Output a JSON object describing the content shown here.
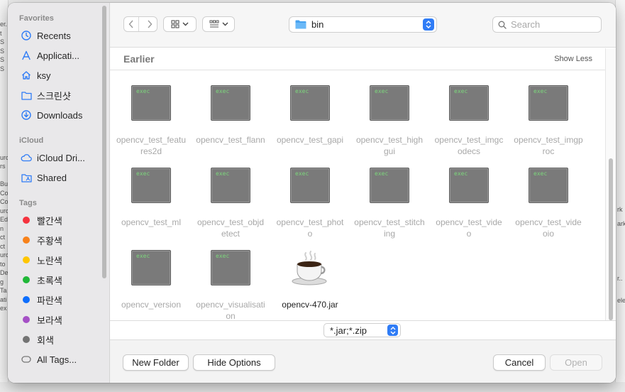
{
  "background": {
    "left_fragments": [
      "er.",
      "t",
      "S",
      "S",
      "S",
      "S",
      "",
      "",
      "",
      "",
      "",
      "",
      "",
      "",
      "",
      "urc",
      "rs",
      "",
      "Bu",
      "Co",
      "Co",
      "urc",
      "Ed",
      "n",
      "ct",
      "ct",
      "urc",
      "to",
      "De",
      "g",
      "Ta",
      "ati",
      "ex"
    ],
    "right_fragments": [
      "rk",
      "ark",
      "r..",
      "ele"
    ]
  },
  "sidebar": {
    "sections": {
      "favorites": "Favorites",
      "icloud": "iCloud",
      "tags": "Tags"
    },
    "favorites": [
      {
        "label": "Recents",
        "icon": "clock-icon"
      },
      {
        "label": "Applicati...",
        "icon": "applications-icon"
      },
      {
        "label": "ksy",
        "icon": "home-icon"
      },
      {
        "label": "스크린샷",
        "icon": "folder-icon"
      },
      {
        "label": "Downloads",
        "icon": "downloads-icon"
      }
    ],
    "icloud": [
      {
        "label": "iCloud Dri...",
        "icon": "cloud-icon"
      },
      {
        "label": "Shared",
        "icon": "shared-folder-icon"
      }
    ],
    "tags": [
      {
        "label": "빨간색",
        "color": "#f5333f"
      },
      {
        "label": "주황색",
        "color": "#f7821b"
      },
      {
        "label": "노란색",
        "color": "#ffc600"
      },
      {
        "label": "초록색",
        "color": "#20b838"
      },
      {
        "label": "파란색",
        "color": "#0d6efd"
      },
      {
        "label": "보라색",
        "color": "#a550c6"
      },
      {
        "label": "회색",
        "color": "#737373"
      },
      {
        "label": "All Tags...",
        "color": ""
      }
    ]
  },
  "toolbar": {
    "path_label": "bin",
    "search_placeholder": "Search"
  },
  "group": {
    "title": "Earlier",
    "toggle": "Show Less"
  },
  "files": [
    {
      "name": "opencv_test_features2d",
      "kind": "exec",
      "enabled": false
    },
    {
      "name": "opencv_test_flann",
      "kind": "exec",
      "enabled": false
    },
    {
      "name": "opencv_test_gapi",
      "kind": "exec",
      "enabled": false
    },
    {
      "name": "opencv_test_highgui",
      "kind": "exec",
      "enabled": false
    },
    {
      "name": "opencv_test_imgcodecs",
      "kind": "exec",
      "enabled": false
    },
    {
      "name": "opencv_test_imgproc",
      "kind": "exec",
      "enabled": false
    },
    {
      "name": "opencv_test_ml",
      "kind": "exec",
      "enabled": false
    },
    {
      "name": "opencv_test_objdetect",
      "kind": "exec",
      "enabled": false
    },
    {
      "name": "opencv_test_photo",
      "kind": "exec",
      "enabled": false
    },
    {
      "name": "opencv_test_stitching",
      "kind": "exec",
      "enabled": false
    },
    {
      "name": "opencv_test_video",
      "kind": "exec",
      "enabled": false
    },
    {
      "name": "opencv_test_videoio",
      "kind": "exec",
      "enabled": false
    },
    {
      "name": "opencv_version",
      "kind": "exec",
      "enabled": false
    },
    {
      "name": "opencv_visualisation",
      "kind": "exec",
      "enabled": false
    },
    {
      "name": "opencv-470.jar",
      "kind": "jar",
      "enabled": true
    }
  ],
  "exec_badge": "exec",
  "filter": {
    "value": "*.jar;*.zip"
  },
  "footer": {
    "new_folder": "New Folder",
    "hide_options": "Hide Options",
    "cancel": "Cancel",
    "open": "Open"
  },
  "colors": {
    "accent": "#2f7cf6",
    "sidebar_bg": "#e9e8ea",
    "disabled_text": "#a8a8a8"
  }
}
